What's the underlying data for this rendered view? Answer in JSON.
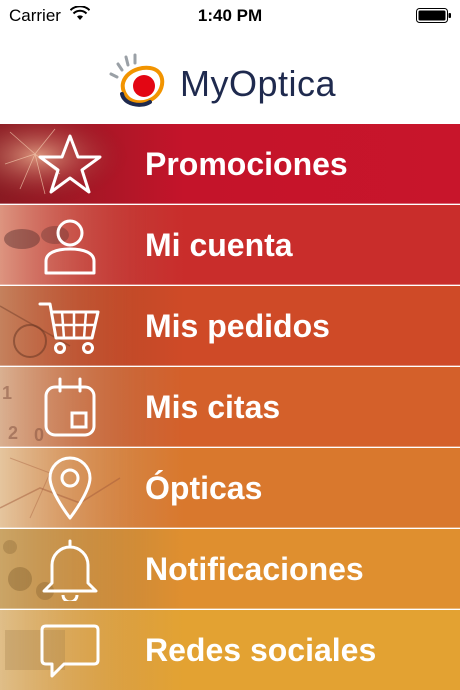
{
  "status_bar": {
    "carrier": "Carrier",
    "time": "1:40 PM",
    "wifi_icon": "wifi-icon",
    "battery_icon": "battery-full-icon"
  },
  "header": {
    "logo_icon": "myoptica-logo-mark",
    "logo_text": "MyOptica"
  },
  "menu": {
    "items": [
      {
        "label": "Promociones",
        "icon": "star-icon",
        "color": "#c4142a"
      },
      {
        "label": "Mi cuenta",
        "icon": "user-icon",
        "color": "#c92d2b"
      },
      {
        "label": "Mis pedidos",
        "icon": "cart-icon",
        "color": "#cf4a27"
      },
      {
        "label": "Mis citas",
        "icon": "calendar-icon",
        "color": "#d4602a"
      },
      {
        "label": "Ópticas",
        "icon": "map-pin-icon",
        "color": "#d9782d"
      },
      {
        "label": "Notificaciones",
        "icon": "bell-icon",
        "color": "#df8f2f"
      },
      {
        "label": "Redes sociales",
        "icon": "chat-bubble-icon",
        "color": "#e3a232"
      }
    ]
  }
}
